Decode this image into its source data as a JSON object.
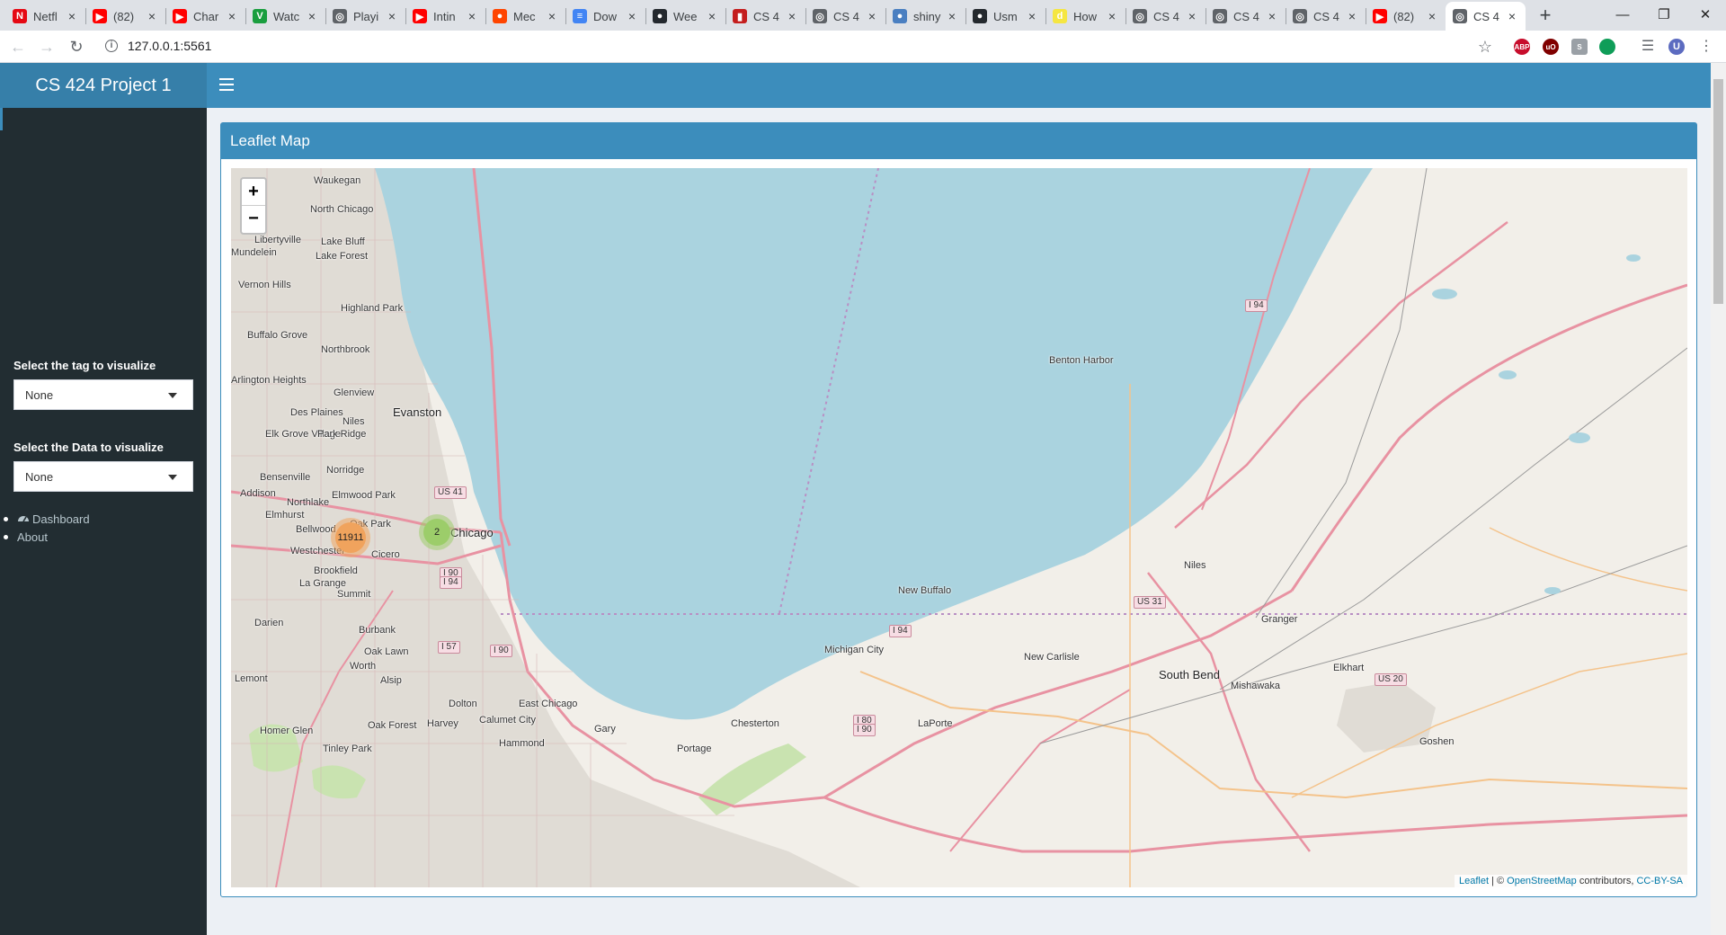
{
  "browser": {
    "tabs": [
      {
        "label": "Netfl",
        "icon": "netflix-icon",
        "color": "#e50914",
        "glyph": "N"
      },
      {
        "label": "(82)",
        "icon": "youtube-icon",
        "color": "#ff0000",
        "glyph": "▶"
      },
      {
        "label": "Char",
        "icon": "youtube-icon",
        "color": "#ff0000",
        "glyph": "▶"
      },
      {
        "label": "Watc",
        "icon": "watch-icon",
        "color": "#1a9e3f",
        "glyph": "V"
      },
      {
        "label": "Playi",
        "icon": "globe-icon",
        "color": "#5f6368",
        "glyph": "◎"
      },
      {
        "label": "Intin",
        "icon": "youtube-icon",
        "color": "#ff0000",
        "glyph": "▶"
      },
      {
        "label": "Mec",
        "icon": "reddit-icon",
        "color": "#ff4500",
        "glyph": "●"
      },
      {
        "label": "Dow",
        "icon": "docs-icon",
        "color": "#4285f4",
        "glyph": "≡"
      },
      {
        "label": "Wee",
        "icon": "github-icon",
        "color": "#24292e",
        "glyph": "●"
      },
      {
        "label": "CS 4",
        "icon": "pdf-icon",
        "color": "#c41e1e",
        "glyph": "▮"
      },
      {
        "label": "CS 4",
        "icon": "globe-icon",
        "color": "#5f6368",
        "glyph": "◎"
      },
      {
        "label": "shiny",
        "icon": "shiny-icon",
        "color": "#4a7fc1",
        "glyph": "●"
      },
      {
        "label": "Usm",
        "icon": "github-icon",
        "color": "#24292e",
        "glyph": "●"
      },
      {
        "label": "How",
        "icon": "dev-icon",
        "color": "#f5e642",
        "glyph": "d"
      },
      {
        "label": "CS 4",
        "icon": "globe-icon",
        "color": "#5f6368",
        "glyph": "◎"
      },
      {
        "label": "CS 4",
        "icon": "globe-icon",
        "color": "#5f6368",
        "glyph": "◎"
      },
      {
        "label": "CS 4",
        "icon": "globe-icon",
        "color": "#5f6368",
        "glyph": "◎"
      },
      {
        "label": "(82)",
        "icon": "youtube-icon",
        "color": "#ff0000",
        "glyph": "▶"
      },
      {
        "label": "CS 4",
        "icon": "globe-icon",
        "color": "#5f6368",
        "glyph": "◎",
        "active": true
      }
    ],
    "url": "127.0.0.1:5561",
    "extensions": [
      {
        "name": "adblock-icon",
        "glyph": "ABP",
        "color": "#c70d2c"
      },
      {
        "name": "ublock-icon",
        "glyph": "uO",
        "color": "#800000"
      },
      {
        "name": "extension-gray-icon",
        "glyph": "S",
        "color": "#9aa0a6"
      },
      {
        "name": "extension-green-icon",
        "glyph": "",
        "color": "#0f9d58"
      }
    ],
    "profile_initial": "U"
  },
  "app": {
    "title": "CS 424 Project 1",
    "sidebar": {
      "tag_label": "Select the tag to visualize",
      "tag_value": "None",
      "data_label": "Select the Data to visualize",
      "data_value": "None",
      "menu": [
        {
          "label": "Dashboard",
          "icon": "dashboard-icon"
        },
        {
          "label": "About"
        }
      ]
    },
    "box_title": "Leaflet Map"
  },
  "map": {
    "zoom_in": "+",
    "zoom_out": "−",
    "clusters": [
      {
        "count": "11911",
        "color": "#f0a35d"
      },
      {
        "count": "2",
        "color": "#9ccd6a"
      }
    ],
    "attribution": {
      "leaflet": "Leaflet",
      "sep": " | © ",
      "osm": "OpenStreetMap",
      "contrib": " contributors, ",
      "license": "CC-BY-SA"
    },
    "places": [
      "Waukegan",
      "North Chicago",
      "Libertyville",
      "Lake Bluff",
      "Mundelein",
      "Lake Forest",
      "Vernon Hills",
      "Highland Park",
      "Buffalo Grove",
      "Northbrook",
      "Arlington Heights",
      "Glenview",
      "Evanston",
      "Des Plaines",
      "Niles",
      "Elk Grove Village",
      "Park Ridge",
      "Bensenville",
      "Norridge",
      "Addison",
      "Northlake",
      "Elmwood Park",
      "Elmhurst",
      "Oak Park",
      "Bellwood",
      "Westchester",
      "Cicero",
      "Brookfield",
      "La Grange",
      "Summit",
      "Darien",
      "Burbank",
      "Oak Lawn",
      "Worth",
      "Lemont",
      "Alsip",
      "Dolton",
      "Homer Glen",
      "Oak Forest",
      "Harvey",
      "Calumet City",
      "Tinley Park",
      "Hammond",
      "East Chicago",
      "Gary",
      "Portage",
      "Chesterton",
      "Michigan City",
      "LaPorte",
      "New Buffalo",
      "Benton Harbor",
      "Niles",
      "South Bend",
      "Mishawaka",
      "Granger",
      "Elkhart",
      "New Carlisle",
      "Goshen",
      "Chicago"
    ],
    "shields": [
      "US 41",
      "I 90",
      "I 94",
      "I 57",
      "I 90",
      "I 94",
      "US 31",
      "I 80",
      "I 90",
      "US 20",
      "I 94"
    ]
  }
}
